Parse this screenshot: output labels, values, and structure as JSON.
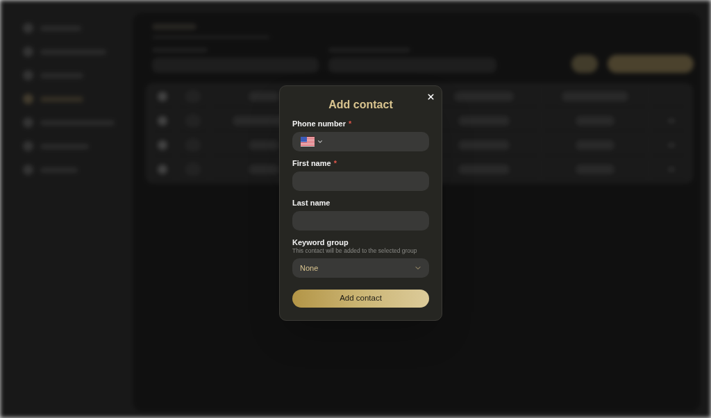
{
  "dialog": {
    "title": "Add contact",
    "required_mark": "*",
    "fields": [
      {
        "kind": "phone",
        "label": "Phone number",
        "required": true
      },
      {
        "kind": "text",
        "label": "First name",
        "required": true
      },
      {
        "kind": "text",
        "label": "Last name",
        "required": false
      },
      {
        "kind": "select",
        "label": "Keyword group",
        "required": false,
        "hint": "This contact will be added to the selected group",
        "value": "None"
      }
    ],
    "submit": "Add contact"
  }
}
